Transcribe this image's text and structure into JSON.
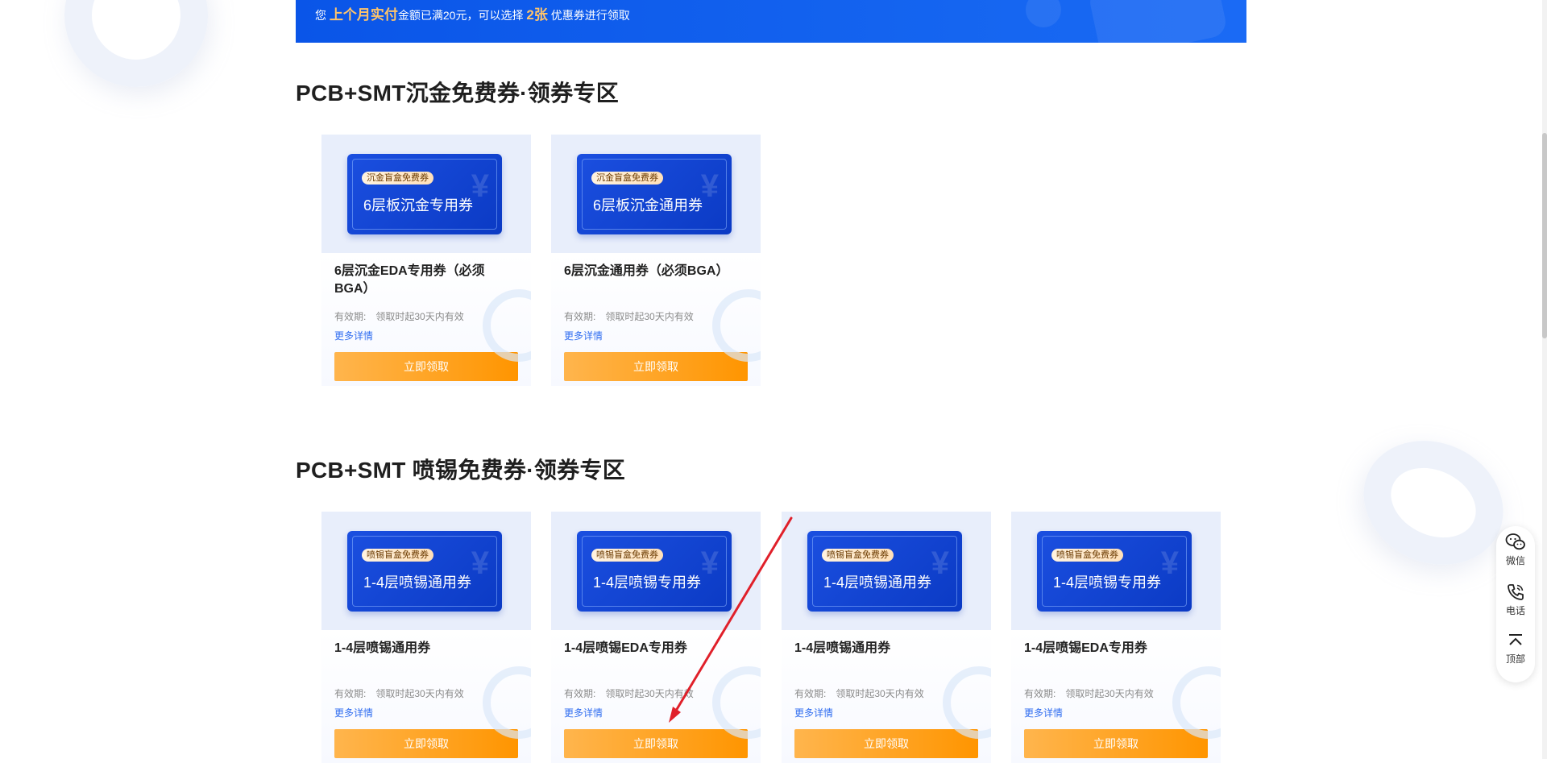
{
  "banner": {
    "prefix": "您",
    "highlight1": "上个月实付",
    "middle": "金额已满20元，可以选择",
    "highlight2": "2张",
    "suffix": "优惠券进行领取"
  },
  "sections": [
    {
      "title": "PCB+SMT沉金免费券·领券专区",
      "cards": [
        {
          "badge": "沉金盲盒免费券",
          "ticket_name": "6层板沉金专用券",
          "title": "6层沉金EDA专用券（必须BGA）",
          "validity_label": "有效期:",
          "validity_value": "领取时起30天内有效",
          "more": "更多详情",
          "button": "立即领取"
        },
        {
          "badge": "沉金盲盒免费券",
          "ticket_name": "6层板沉金通用券",
          "title": "6层沉金通用券（必须BGA）",
          "validity_label": "有效期:",
          "validity_value": "领取时起30天内有效",
          "more": "更多详情",
          "button": "立即领取"
        }
      ]
    },
    {
      "title": "PCB+SMT 喷锡免费券·领券专区",
      "cards": [
        {
          "badge": "喷锡盲盒免费券",
          "ticket_name": "1-4层喷锡通用券",
          "title": "1-4层喷锡通用券",
          "validity_label": "有效期:",
          "validity_value": "领取时起30天内有效",
          "more": "更多详情",
          "button": "立即领取"
        },
        {
          "badge": "喷锡盲盒免费券",
          "ticket_name": "1-4层喷锡专用券",
          "title": "1-4层喷锡EDA专用券",
          "validity_label": "有效期:",
          "validity_value": "领取时起30天内有效",
          "more": "更多详情",
          "button": "立即领取"
        },
        {
          "badge": "喷锡盲盒免费券",
          "ticket_name": "1-4层喷锡通用券",
          "title": "1-4层喷锡通用券",
          "validity_label": "有效期:",
          "validity_value": "领取时起30天内有效",
          "more": "更多详情",
          "button": "立即领取"
        },
        {
          "badge": "喷锡盲盒免费券",
          "ticket_name": "1-4层喷锡专用券",
          "title": "1-4层喷锡EDA专用券",
          "validity_label": "有效期:",
          "validity_value": "领取时起30天内有效",
          "more": "更多详情",
          "button": "立即领取"
        }
      ]
    }
  ],
  "side_tools": [
    {
      "label": "微信",
      "icon": "wechat-icon"
    },
    {
      "label": "电话",
      "icon": "phone-icon"
    },
    {
      "label": "顶部",
      "icon": "back-to-top-icon"
    }
  ],
  "colors": {
    "banner_blue": "#0a55e8",
    "highlight_orange": "#ffc46b",
    "button_orange": "#ff9500",
    "link_blue": "#2f6df0",
    "annotation_red": "#e0202a"
  }
}
